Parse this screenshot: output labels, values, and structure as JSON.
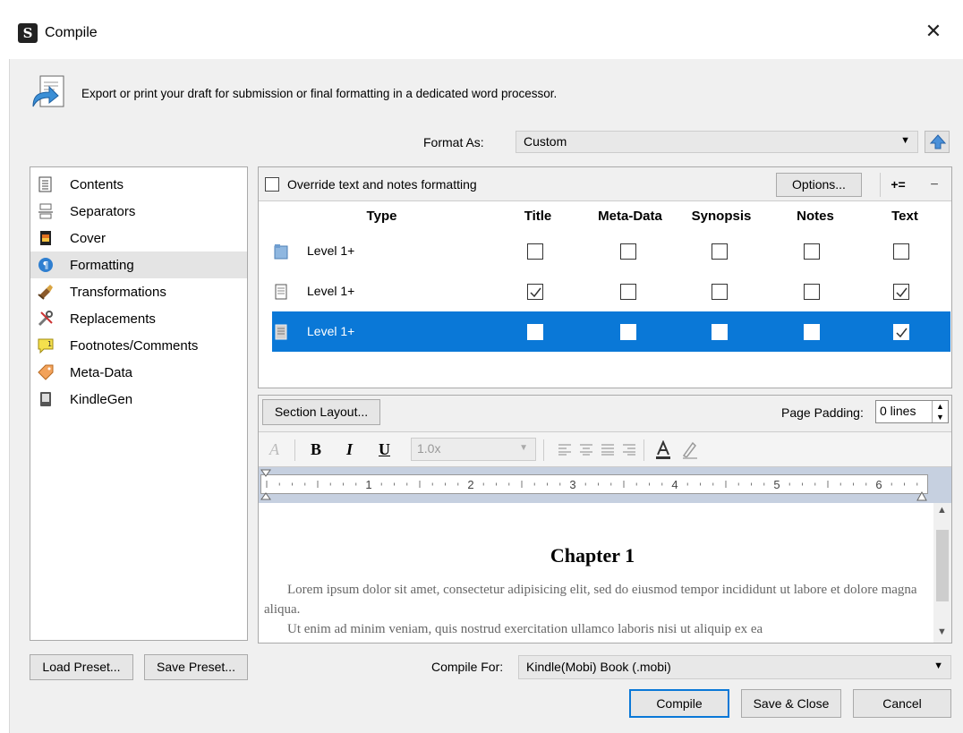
{
  "window": {
    "title": "Compile",
    "close_glyph": "✕",
    "app_icon_letter": "S"
  },
  "description": "Export or print your draft for submission or final formatting in a dedicated word processor.",
  "format_as": {
    "label": "Format As:",
    "value": "Custom"
  },
  "sidebar": {
    "items": [
      {
        "label": "Contents",
        "icon": "contents-list-icon"
      },
      {
        "label": "Separators",
        "icon": "separators-icon"
      },
      {
        "label": "Cover",
        "icon": "cover-image-icon"
      },
      {
        "label": "Formatting",
        "icon": "formatting-paragraph-icon",
        "selected": true
      },
      {
        "label": "Transformations",
        "icon": "brush-icon"
      },
      {
        "label": "Replacements",
        "icon": "tools-icon"
      },
      {
        "label": "Footnotes/Comments",
        "icon": "note-icon"
      },
      {
        "label": "Meta-Data",
        "icon": "tag-icon"
      },
      {
        "label": "KindleGen",
        "icon": "kindle-icon"
      }
    ]
  },
  "formatting_toolbar": {
    "override_label": "Override text and notes formatting",
    "override_checked": false,
    "options_label": "Options...",
    "add_label": "+=",
    "remove_label": "−"
  },
  "grid": {
    "columns": [
      "Type",
      "Title",
      "Meta-Data",
      "Synopsis",
      "Notes",
      "Text"
    ],
    "rows": [
      {
        "label": "Level 1+",
        "icon": "folder-icon",
        "checks": [
          false,
          false,
          false,
          false,
          false
        ],
        "selected": false
      },
      {
        "label": "Level 1+",
        "icon": "document-icon",
        "checks": [
          true,
          false,
          false,
          false,
          true
        ],
        "selected": false
      },
      {
        "label": "Level 1+",
        "icon": "document-icon",
        "checks": [
          false,
          false,
          false,
          false,
          true
        ],
        "selected": true
      }
    ]
  },
  "section": {
    "layout_label": "Section Layout...",
    "page_padding_label": "Page Padding:",
    "page_padding_value": "0 lines"
  },
  "text_format": {
    "line_spacing": "1.0x",
    "bold": "B",
    "italic": "I",
    "underline": "U",
    "font_glyph": "A"
  },
  "ruler_numbers": [
    "1",
    "2",
    "3",
    "4",
    "5",
    "6"
  ],
  "preview": {
    "heading": "Chapter 1",
    "paragraph1": "Lorem ipsum dolor sit amet, consectetur adipisicing elit, sed do eiusmod tempor incididunt ut labore et dolore magna aliqua.",
    "paragraph2": "Ut enim ad minim veniam, quis nostrud exercitation ullamco laboris nisi ut aliquip ex ea"
  },
  "presets": {
    "load_label": "Load Preset...",
    "save_label": "Save Preset..."
  },
  "compile_for": {
    "label": "Compile For:",
    "value": "Kindle(Mobi) Book (.mobi)"
  },
  "actions": {
    "compile": "Compile",
    "save_close": "Save & Close",
    "cancel": "Cancel"
  },
  "colors": {
    "selection": "#0a78d7",
    "sidebar_selected": "#e4e4e4",
    "panel_bg": "#f0f0f0"
  }
}
